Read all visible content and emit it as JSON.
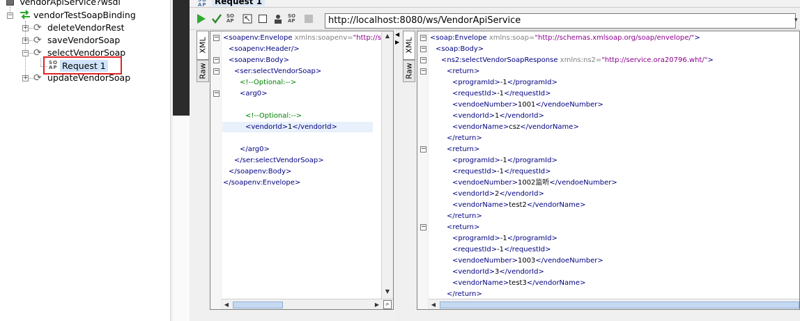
{
  "tree": {
    "root_label": "VendorApiService?wsdl",
    "binding_label": "vendorTestSoapBinding",
    "operations": [
      {
        "label": "deleteVendorRest"
      },
      {
        "label": "saveVendorSoap"
      },
      {
        "label": "selectVendorSoap"
      },
      {
        "label": "updateVendorSoap"
      }
    ],
    "request_label": "Request 1",
    "soap_icon_text": "SO AP"
  },
  "window": {
    "title": "Request 1",
    "url": "http://localhost:8080/ws/VendorApiService",
    "toolbar": {
      "run_icon": "play-icon",
      "highlight_color": "#e32424"
    }
  },
  "tabs": {
    "xml": "XML",
    "raw": "Raw"
  },
  "request_lines": [
    {
      "i": 0,
      "parts": [
        [
          "tg",
          "<soapenv:Envelope "
        ],
        [
          "at",
          "xmlns:soapenv="
        ],
        [
          "av",
          "\"http://sche"
        ]
      ]
    },
    {
      "i": 1,
      "parts": [
        [
          "tg",
          "<soapenv:Header/>"
        ]
      ]
    },
    {
      "i": 1,
      "parts": [
        [
          "tg",
          "<soapenv:Body>"
        ]
      ]
    },
    {
      "i": 2,
      "parts": [
        [
          "tg",
          "<ser:selectVendorSoap>"
        ]
      ]
    },
    {
      "i": 3,
      "parts": [
        [
          "cm",
          "<!--Optional:-->"
        ]
      ]
    },
    {
      "i": 3,
      "parts": [
        [
          "tg",
          "<arg0>"
        ]
      ]
    },
    {
      "i": 4,
      "parts": []
    },
    {
      "i": 4,
      "parts": [
        [
          "cm",
          "<!--Optional:-->"
        ]
      ]
    },
    {
      "i": 4,
      "parts": [
        [
          "tg",
          "<vendorId>"
        ],
        [
          "tx",
          "1"
        ],
        [
          "tg",
          "</vendorId>"
        ]
      ]
    },
    {
      "i": 4,
      "parts": []
    },
    {
      "i": 3,
      "parts": [
        [
          "tg",
          "</arg0>"
        ]
      ]
    },
    {
      "i": 2,
      "parts": [
        [
          "tg",
          "</ser:selectVendorSoap>"
        ]
      ]
    },
    {
      "i": 1,
      "parts": [
        [
          "tg",
          "</soapenv:Body>"
        ]
      ]
    },
    {
      "i": 0,
      "parts": [
        [
          "tg",
          "</soapenv:Envelope>"
        ]
      ]
    }
  ],
  "response_lines": [
    {
      "i": 0,
      "parts": [
        [
          "tg",
          "<soap:Envelope "
        ],
        [
          "at",
          "xmlns:soap="
        ],
        [
          "av",
          "\"http://schemas.xmlsoap.org/soap/envelope/\""
        ],
        [
          "tg",
          ">"
        ]
      ]
    },
    {
      "i": 1,
      "parts": [
        [
          "tg",
          "<soap:Body>"
        ]
      ]
    },
    {
      "i": 2,
      "parts": [
        [
          "tg",
          "<ns2:selectVendorSoapResponse "
        ],
        [
          "at",
          "xmlns:ns2="
        ],
        [
          "av",
          "\"http://service.ora20796.wht/\""
        ],
        [
          "tg",
          ">"
        ]
      ]
    },
    {
      "i": 3,
      "parts": [
        [
          "tg",
          "<return>"
        ]
      ]
    },
    {
      "i": 4,
      "parts": [
        [
          "tg",
          "<programId>"
        ],
        [
          "tx",
          "-1"
        ],
        [
          "tg",
          "</programId>"
        ]
      ]
    },
    {
      "i": 4,
      "parts": [
        [
          "tg",
          "<requestId>"
        ],
        [
          "tx",
          "-1"
        ],
        [
          "tg",
          "</requestId>"
        ]
      ]
    },
    {
      "i": 4,
      "parts": [
        [
          "tg",
          "<vendoeNumber>"
        ],
        [
          "tx",
          "1001"
        ],
        [
          "tg",
          "</vendoeNumber>"
        ]
      ]
    },
    {
      "i": 4,
      "parts": [
        [
          "tg",
          "<vendorId>"
        ],
        [
          "tx",
          "1"
        ],
        [
          "tg",
          "</vendorId>"
        ]
      ]
    },
    {
      "i": 4,
      "parts": [
        [
          "tg",
          "<vendorName>"
        ],
        [
          "tx",
          "csz"
        ],
        [
          "tg",
          "</vendorName>"
        ]
      ]
    },
    {
      "i": 3,
      "parts": [
        [
          "tg",
          "</return>"
        ]
      ]
    },
    {
      "i": 3,
      "parts": [
        [
          "tg",
          "<return>"
        ]
      ]
    },
    {
      "i": 4,
      "parts": [
        [
          "tg",
          "<programId>"
        ],
        [
          "tx",
          "-1"
        ],
        [
          "tg",
          "</programId>"
        ]
      ]
    },
    {
      "i": 4,
      "parts": [
        [
          "tg",
          "<requestId>"
        ],
        [
          "tx",
          "-1"
        ],
        [
          "tg",
          "</requestId>"
        ]
      ]
    },
    {
      "i": 4,
      "parts": [
        [
          "tg",
          "<vendoeNumber>"
        ],
        [
          "tx",
          "1002监听"
        ],
        [
          "tg",
          "</vendoeNumber>"
        ]
      ]
    },
    {
      "i": 4,
      "parts": [
        [
          "tg",
          "<vendorId>"
        ],
        [
          "tx",
          "2"
        ],
        [
          "tg",
          "</vendorId>"
        ]
      ]
    },
    {
      "i": 4,
      "parts": [
        [
          "tg",
          "<vendorName>"
        ],
        [
          "tx",
          "test2"
        ],
        [
          "tg",
          "</vendorName>"
        ]
      ]
    },
    {
      "i": 3,
      "parts": [
        [
          "tg",
          "</return>"
        ]
      ]
    },
    {
      "i": 3,
      "parts": [
        [
          "tg",
          "<return>"
        ]
      ]
    },
    {
      "i": 4,
      "parts": [
        [
          "tg",
          "<programId>"
        ],
        [
          "tx",
          "-1"
        ],
        [
          "tg",
          "</programId>"
        ]
      ]
    },
    {
      "i": 4,
      "parts": [
        [
          "tg",
          "<requestId>"
        ],
        [
          "tx",
          "-1"
        ],
        [
          "tg",
          "</requestId>"
        ]
      ]
    },
    {
      "i": 4,
      "parts": [
        [
          "tg",
          "<vendoeNumber>"
        ],
        [
          "tx",
          "1003"
        ],
        [
          "tg",
          "</vendoeNumber>"
        ]
      ]
    },
    {
      "i": 4,
      "parts": [
        [
          "tg",
          "<vendorId>"
        ],
        [
          "tx",
          "3"
        ],
        [
          "tg",
          "</vendorId>"
        ]
      ]
    },
    {
      "i": 4,
      "parts": [
        [
          "tg",
          "<vendorName>"
        ],
        [
          "tx",
          "test3"
        ],
        [
          "tg",
          "</vendorName>"
        ]
      ]
    },
    {
      "i": 3,
      "parts": [
        [
          "tg",
          "</return>"
        ]
      ]
    }
  ]
}
